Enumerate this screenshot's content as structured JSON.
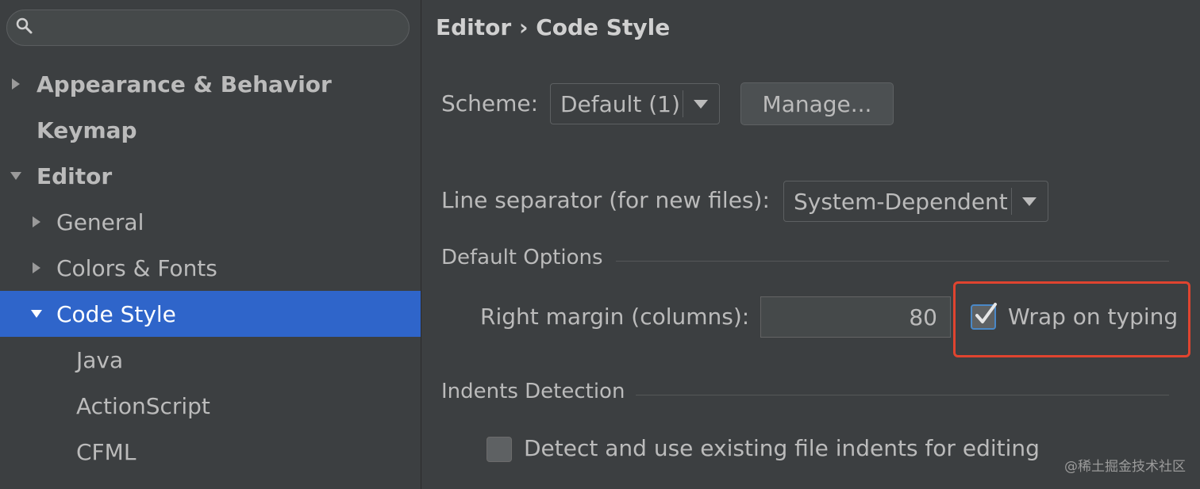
{
  "sidebar": {
    "search": {
      "value": "",
      "placeholder": ""
    },
    "items": [
      {
        "label": "Appearance & Behavior"
      },
      {
        "label": "Keymap"
      },
      {
        "label": "Editor"
      },
      {
        "label": "General"
      },
      {
        "label": "Colors & Fonts"
      },
      {
        "label": "Code Style"
      },
      {
        "label": "Java"
      },
      {
        "label": "ActionScript"
      },
      {
        "label": "CFML"
      }
    ],
    "selected_item": "Code Style",
    "selected_color": "#2f65ca"
  },
  "main": {
    "breadcrumb": "Editor › Code Style",
    "scheme": {
      "label": "Scheme:",
      "value": "Default (1)",
      "manage_button": "Manage..."
    },
    "line_separator": {
      "label": "Line separator (for new files):",
      "value": "System-Dependent"
    },
    "default_options": {
      "title": "Default Options",
      "right_margin_label": "Right margin (columns):",
      "right_margin_value": "80",
      "wrap_on_typing_label": "Wrap on typing",
      "wrap_on_typing_checked": true
    },
    "indents_detection": {
      "title": "Indents Detection",
      "detect_label": "Detect and use existing file indents for editing",
      "detect_checked": false
    }
  },
  "highlight_color": "#e0442f",
  "watermark": "@稀土掘金技术社区"
}
